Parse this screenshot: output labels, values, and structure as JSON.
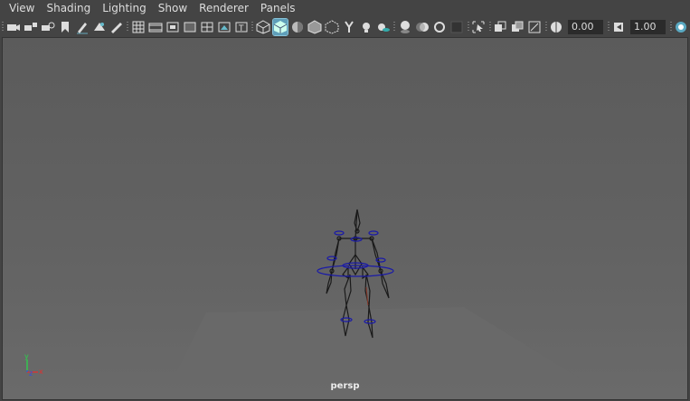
{
  "menu": [
    "View",
    "Shading",
    "Lighting",
    "Show",
    "Renderer",
    "Panels"
  ],
  "toolbar": {
    "groups": [
      [
        "camera-icon",
        "camera-attributes-icon",
        "camera-lock-icon",
        "bookmark-icon",
        "grease-pencil-icon",
        "image-plane-icon",
        "2d-pan-zoom-icon"
      ],
      [
        "grid-icon",
        "film-gate-icon",
        "resolution-gate-icon",
        "gate-mask-icon",
        "field-chart-icon",
        "safe-action-icon",
        "safe-title-icon"
      ],
      [
        "wireframe-icon",
        "smooth-shade-icon",
        "use-default-material-icon",
        "wireframe-on-shaded-icon",
        "xray-icon",
        "xray-joints-icon",
        "use-all-lights-icon",
        "shadows-icon"
      ],
      [
        "ambient-occlusion-icon",
        "motion-blur-icon",
        "anti-aliasing-icon",
        "depth-of-field-icon"
      ],
      [
        "isolate-select-icon"
      ],
      [
        "xray-active-components-icon",
        "textured-icon",
        "hud-icon"
      ],
      [
        "exposure-icon"
      ],
      [
        "gamma-icon"
      ],
      [
        "color-management-icon"
      ]
    ],
    "active_icon": "smooth-shade-icon",
    "exposure_value": "0.00",
    "gamma_value": "1.00"
  },
  "viewport": {
    "camera_label": "persp",
    "axis": {
      "x": "x",
      "y": "y",
      "z": "z"
    },
    "background_color": "#5e5e5e",
    "ground_color": "#696969",
    "skeleton_color": "#1a1a1a",
    "controls_color": "#1a1aa8"
  }
}
